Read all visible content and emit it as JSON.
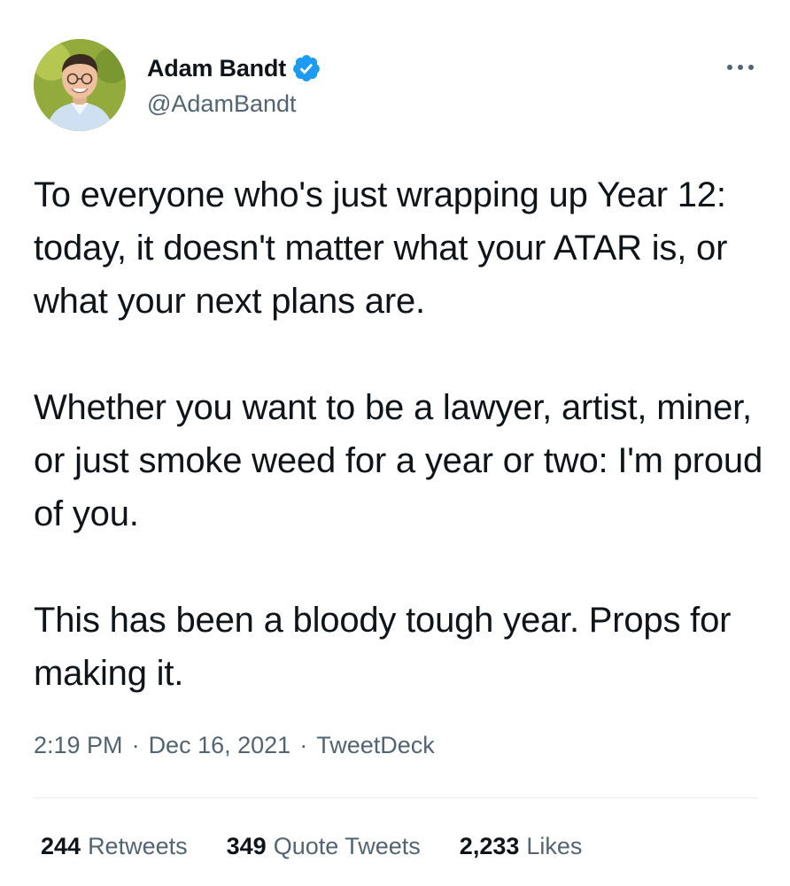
{
  "author": {
    "display_name": "Adam Bandt",
    "handle": "@AdamBandt",
    "verified_icon": "verified-badge-icon",
    "verified_color": "#1d9bf0"
  },
  "menu": {
    "icon": "more-horizontal-icon"
  },
  "tweet": {
    "paragraphs": [
      "To everyone who's just wrapping up Year 12: today, it doesn't matter what your ATAR is, or what your next plans are.",
      "Whether you want to be a lawyer, artist, miner, or just smoke weed for a year or two: I'm proud of you.",
      "This has been a bloody tough year. Props for making it."
    ]
  },
  "meta": {
    "time": "2:19 PM",
    "separator": "·",
    "date": "Dec 16, 2021",
    "source": "TweetDeck"
  },
  "stats": {
    "retweets": {
      "count": "244",
      "label": "Retweets"
    },
    "quote_tweets": {
      "count": "349",
      "label": "Quote Tweets"
    },
    "likes": {
      "count": "2,233",
      "label": "Likes"
    }
  },
  "colors": {
    "text_primary": "#0f1419",
    "text_secondary": "#536471",
    "divider": "#e6ecf0"
  }
}
